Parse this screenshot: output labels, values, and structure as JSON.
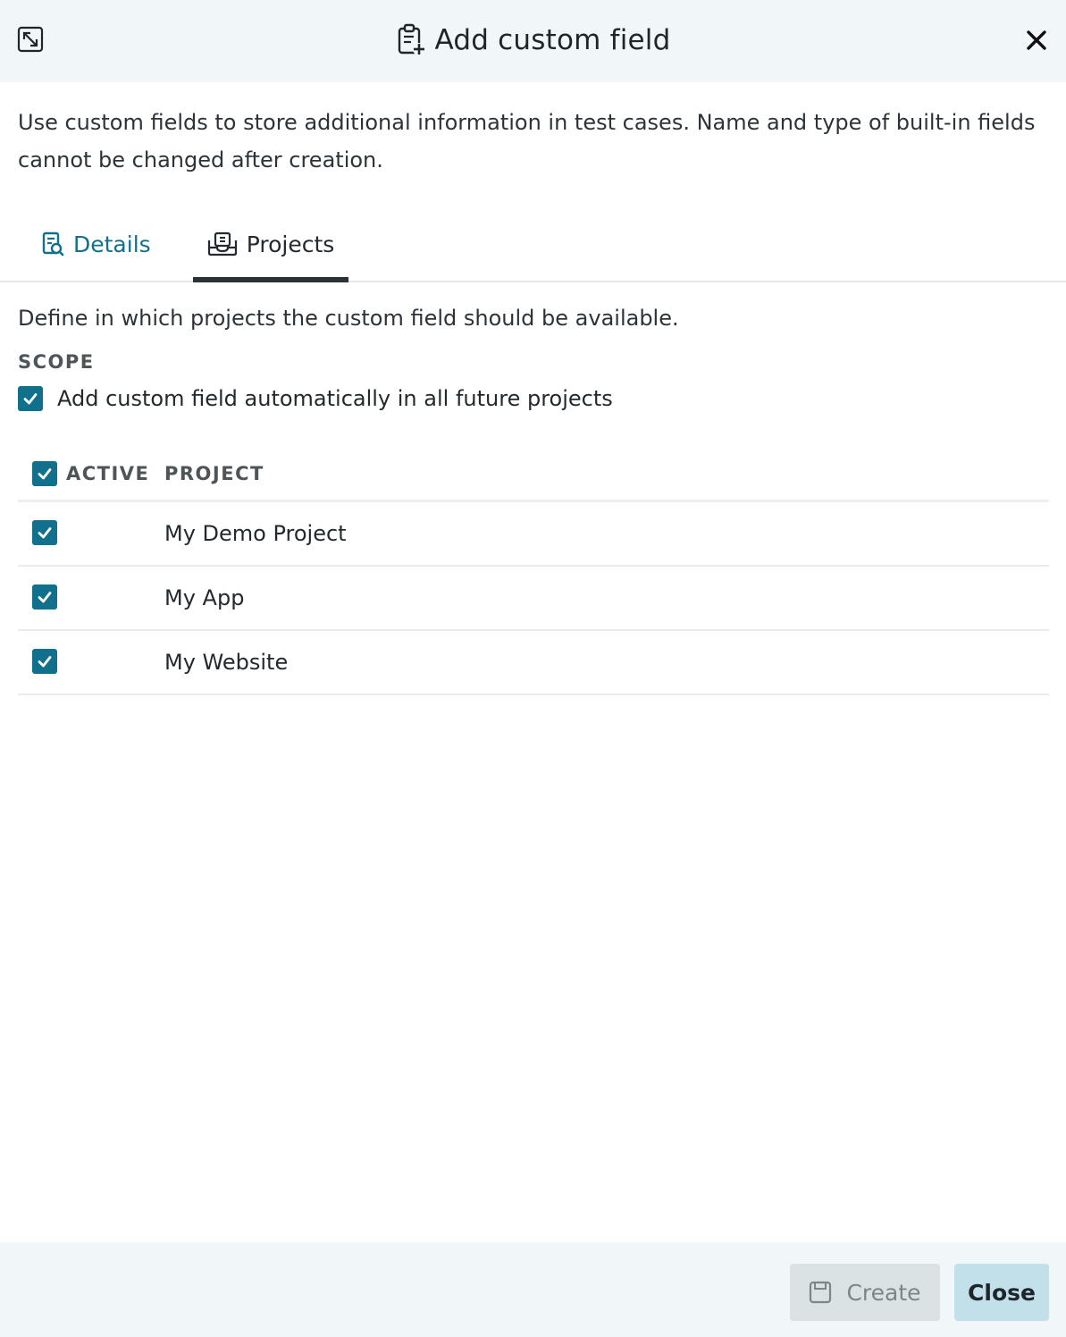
{
  "dialog": {
    "title": "Add custom field",
    "intro": "Use custom fields to store additional information in test cases. Name and type of built-in fields cannot be changed after creation."
  },
  "tabs": [
    {
      "label": "Details",
      "icon": "document-search-icon",
      "active": false
    },
    {
      "label": "Projects",
      "icon": "projects-icon",
      "active": true
    }
  ],
  "projects_panel": {
    "description": "Define in which projects the custom field should be available.",
    "scope_label": "SCOPE",
    "scope_checkbox_label": "Add custom field automatically in all future projects",
    "scope_checked": true
  },
  "table": {
    "columns": [
      "ACTIVE",
      "PROJECT"
    ],
    "header_checked": true,
    "rows": [
      {
        "active": true,
        "project": "My Demo Project"
      },
      {
        "active": true,
        "project": "My App"
      },
      {
        "active": true,
        "project": "My Website"
      }
    ]
  },
  "footer": {
    "create_label": "Create",
    "create_disabled": true,
    "close_label": "Close"
  },
  "colors": {
    "accent": "#11708b",
    "header_bg": "#f1f7f8",
    "close_button_bg": "#c1e0e9",
    "disabled_button_bg": "#dbe2e4"
  }
}
